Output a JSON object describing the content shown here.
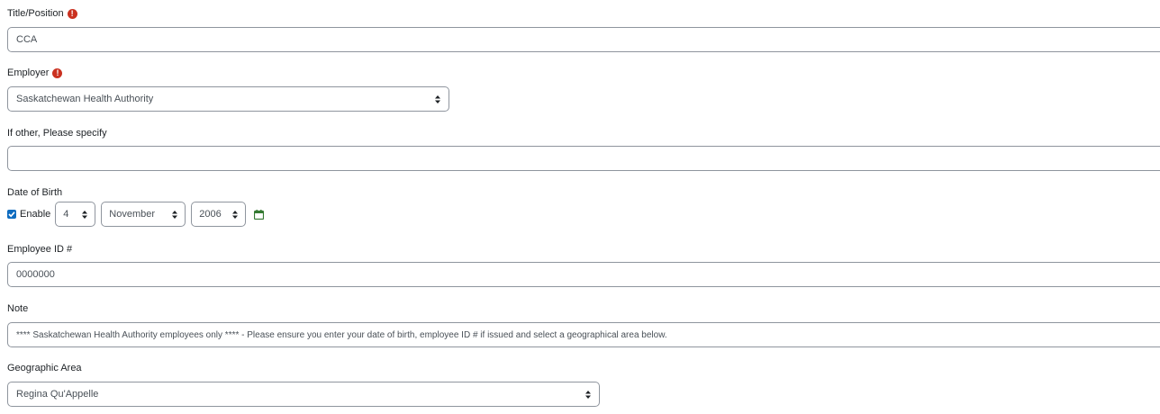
{
  "title_position": {
    "label": "Title/Position",
    "value": "CCA",
    "required": true
  },
  "employer": {
    "label": "Employer",
    "selected": "Saskatchewan Health Authority",
    "required": true
  },
  "other_employer": {
    "label": "If other, Please specify",
    "value": ""
  },
  "date_of_birth": {
    "label": "Date of Birth",
    "enable_label": "Enable",
    "enabled": true,
    "day": "4",
    "month": "November",
    "year": "2006"
  },
  "employee_id": {
    "label": "Employee ID #",
    "value": "0000000"
  },
  "note": {
    "label": "Note",
    "value": "**** Saskatchewan Health Authority employees only **** - Please ensure you enter your date of birth, employee ID # if issued and select a geographical area below."
  },
  "geographic_area": {
    "label": "Geographic Area",
    "selected": "Regina Qu'Appelle"
  },
  "colors": {
    "required_icon": "#ca3120",
    "checkbox": "#0f6cbf",
    "calendar_icon": "#357a32",
    "border": "#8f959e"
  },
  "icons": {
    "required": "exclamation-circle-icon",
    "select_caret": "sort-caret-icon",
    "calendar": "calendar-icon",
    "checkbox": "checkbox-checked-icon"
  }
}
